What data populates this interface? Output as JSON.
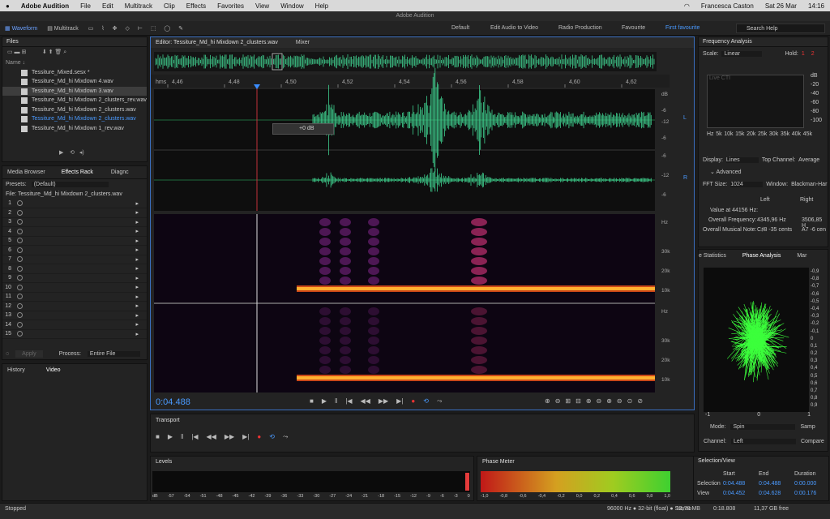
{
  "mac": {
    "app": "Adobe Audition",
    "menus": [
      "File",
      "Edit",
      "Multitrack",
      "Clip",
      "Effects",
      "Favorites",
      "View",
      "Window",
      "Help"
    ],
    "user": "Francesca Caston",
    "date": "Sat 26 Mar",
    "time": "14:16"
  },
  "window_title": "Adobe Audition",
  "toolbar": {
    "waveform": "Waveform",
    "multitrack": "Multitrack",
    "workspaces": [
      "Default",
      "Edit Audio to Video",
      "Radio Production",
      "Favourite",
      "First favourite"
    ],
    "search": "Search Help"
  },
  "files": {
    "title": "Files",
    "column": "Name ↓",
    "items": [
      "Tessiture_Mixed.sesx *",
      "Tessiture_Md_hi Mixdown 4.wav",
      "Tessiture_Md_hi Mixdown 3.wav",
      "Tessiture_Md_hi Mixdown 2_clusters_rev.wav",
      "Tessiture_Md_hi Mixdown 2_clusters.wav",
      "Tessiture_Md_hi Mixdown 2_clusters.wav",
      "Tessiture_Md_hi Mixdown 1_rev.wav"
    ]
  },
  "effects": {
    "tabs": [
      "Media Browser",
      "Effects Rack",
      "Diagnc"
    ],
    "presets_label": "Presets:",
    "preset": "(Default)",
    "file_label": "File: Tessiture_Md_hi Mixdown 2_clusters.wav",
    "slots": [
      "1",
      "2",
      "3",
      "4",
      "5",
      "6",
      "7",
      "8",
      "9",
      "10",
      "11",
      "12",
      "13",
      "14",
      "15"
    ],
    "apply": "Apply",
    "process_label": "Process:",
    "process": "Entire File"
  },
  "history": {
    "tabs": [
      "History",
      "Video"
    ]
  },
  "editor": {
    "tab": "Editor: Tessiture_Md_hi Mixdown 2_clusters.wav",
    "mixer": "Mixer",
    "ruler_unit": "hms",
    "ruler": [
      "4,46",
      "4,48",
      "4,50",
      "4,52",
      "4,54",
      "4,56",
      "4,58",
      "4,60",
      "4,62"
    ],
    "db_labels": [
      "dB",
      "-6",
      "-12",
      "-6",
      "-6",
      "-12",
      "-6"
    ],
    "hz_labels": [
      "Hz",
      "30k",
      "20k",
      "10k",
      "Hz",
      "30k",
      "20k",
      "10k"
    ],
    "gain": "+0 dB",
    "ch_L": "L",
    "ch_R": "R",
    "time": "0:04.488"
  },
  "transport": {
    "title": "Transport"
  },
  "levels": {
    "title": "Levels",
    "scale": [
      "dB",
      "-57",
      "-54",
      "-51",
      "-48",
      "-45",
      "-42",
      "-39",
      "-36",
      "-33",
      "-30",
      "-27",
      "-24",
      "-21",
      "-18",
      "-15",
      "-12",
      "-9",
      "-6",
      "-3",
      "0"
    ]
  },
  "phase_meter": {
    "title": "Phase Meter",
    "scale": [
      "-1,0",
      "-0,8",
      "-0,6",
      "-0,4",
      "-0,2",
      "0,0",
      "0,2",
      "0,4",
      "0,6",
      "0,8",
      "1,0"
    ]
  },
  "freq": {
    "title": "Frequency Analysis",
    "scale_label": "Scale:",
    "scale": "Linear",
    "hold_label": "Hold:",
    "hold": [
      "1",
      "2"
    ],
    "live": "Live CTI",
    "db": [
      "dB",
      "-20",
      "-40",
      "-60",
      "-80",
      "-100"
    ],
    "hz": [
      "Hz",
      "5k",
      "10k",
      "15k",
      "20k",
      "25k",
      "30k",
      "35k",
      "40k",
      "45k"
    ],
    "display_label": "Display:",
    "display": "Lines",
    "topch_label": "Top Channel:",
    "topch": "Average",
    "advanced": "Advanced",
    "fft_label": "FFT Size:",
    "fft": "1024",
    "window_label": "Window:",
    "window": "Blackman-Har",
    "left": "Left",
    "right": "Right",
    "val_label": "Value at 44156 Hz:",
    "overall_freq_label": "Overall Frequency:",
    "overall_freq": "4345,96 Hz",
    "overall_freq_r": "3506,85 H",
    "note_label": "Overall Musical Note:",
    "note_l": "C♯8 -35 cents",
    "note_r": "A7 -6 cen"
  },
  "phase": {
    "tabs": [
      "e Statistics",
      "Phase Analysis",
      "Mar"
    ],
    "scale": [
      "-0,9",
      "-0,8",
      "-0,7",
      "-0,6",
      "-0,5",
      "-0,4",
      "-0,3",
      "-0,2",
      "-0,1",
      "0",
      "0,1",
      "0,2",
      "0,3",
      "0,4",
      "0,5",
      "0,6",
      "0,7",
      "0,8",
      "0,9"
    ],
    "x": [
      "-1",
      "0",
      "1"
    ],
    "mode_label": "Mode:",
    "mode": "Spin",
    "sample": "Samp",
    "channel_label": "Channel:",
    "channel": "Left",
    "compare": "Compare"
  },
  "selection": {
    "title": "Selection/View",
    "start": "Start",
    "end": "End",
    "duration": "Duration",
    "sel_label": "Selection",
    "sel": [
      "0:04.488",
      "0:04.488",
      "0:00.000"
    ],
    "view_label": "View",
    "view": [
      "0:04.452",
      "0:04.628",
      "0:00.176"
    ]
  },
  "status": {
    "left": "Stopped",
    "info": "96000 Hz ● 32-bit (float) ● Stereo",
    "size": "13,78 MB",
    "dur": "0:18.808",
    "free": "11,37 GB free"
  }
}
